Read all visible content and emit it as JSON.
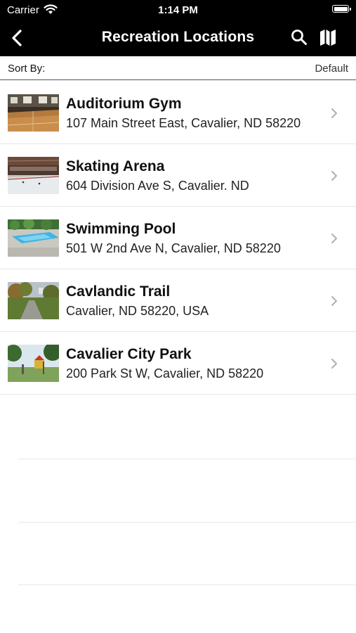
{
  "status": {
    "carrier": "Carrier",
    "time": "1:14 PM"
  },
  "nav": {
    "title": "Recreation Locations",
    "back_icon": "chevron-left-icon",
    "search_icon": "search-icon",
    "map_icon": "map-icon"
  },
  "sort": {
    "label": "Sort By:",
    "value": "Default"
  },
  "locations": [
    {
      "name": "Auditorium Gym",
      "address": "107 Main Street East, Cavalier, ND 58220"
    },
    {
      "name": "Skating Arena",
      "address": "604 Division Ave S, Cavalier. ND"
    },
    {
      "name": "Swimming Pool",
      "address": "501 W 2nd Ave N, Cavalier, ND 58220"
    },
    {
      "name": "Cavlandic Trail",
      "address": "Cavalier, ND 58220, USA"
    },
    {
      "name": "Cavalier City Park",
      "address": "200 Park St W, Cavalier, ND 58220"
    }
  ]
}
